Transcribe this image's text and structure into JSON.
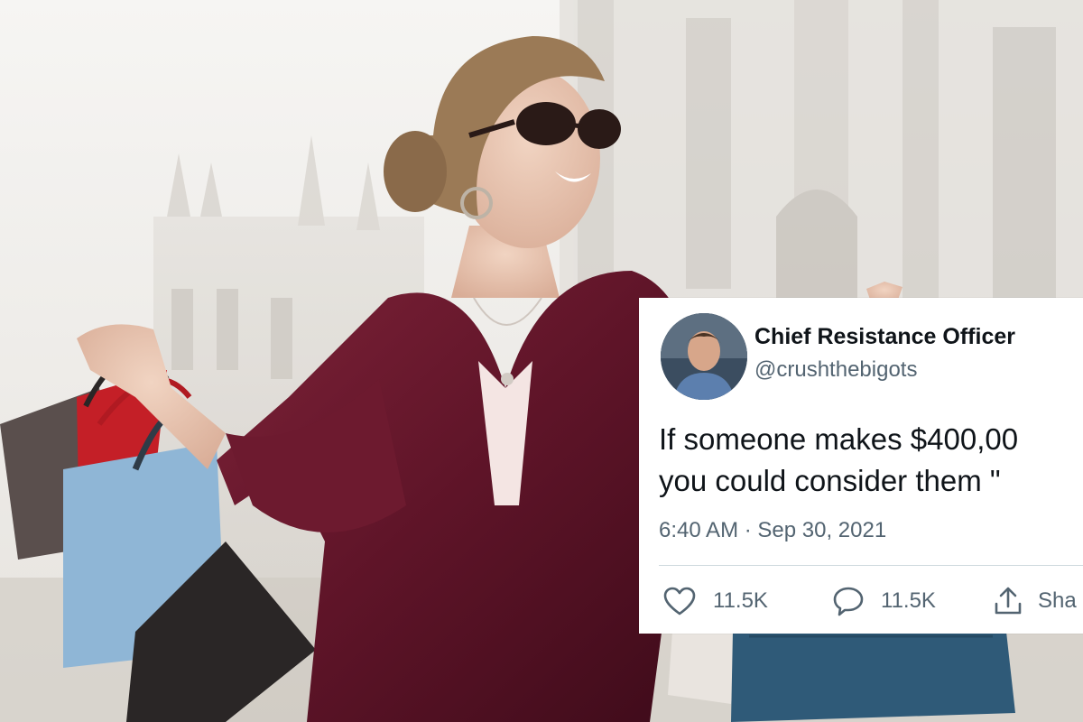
{
  "tweet": {
    "display_name": "Chief Resistance Officer",
    "handle": "@crushthebigots",
    "text_line1": "If someone makes $400,00",
    "text_line2": "you could consider them \"",
    "timestamp": "6:40 AM · Sep 30, 2021",
    "likes": "11.5K",
    "replies": "11.5K",
    "share_label": "Sha"
  },
  "icons": {
    "like": "heart-icon",
    "reply": "comment-bubble-icon",
    "share": "share-upload-icon"
  },
  "colors": {
    "dress": "#6b1a2e",
    "tweet_text": "#0f1419",
    "tweet_secondary": "#536471",
    "divider": "#cfd9de"
  }
}
